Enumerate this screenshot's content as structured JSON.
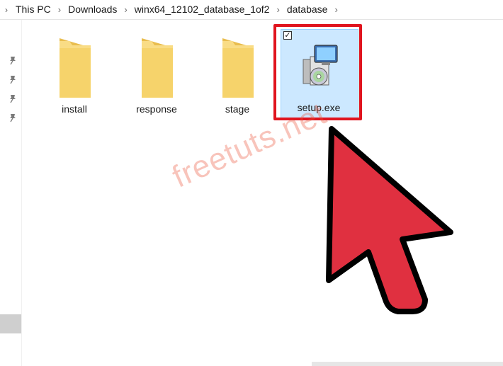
{
  "breadcrumb": {
    "items": [
      "This PC",
      "Downloads",
      "winx64_12102_database_1of2",
      "database"
    ]
  },
  "files": {
    "install": "install",
    "response": "response",
    "stage": "stage",
    "setup": "setup.exe"
  },
  "watermark": "freetuts.net",
  "colors": {
    "folder": "#f6d36b",
    "selection": "#cce8ff",
    "highlight_frame": "#e0141e",
    "arrow_fill": "#e03040",
    "arrow_stroke": "#000000"
  },
  "icons": {
    "nav_arrow": "chevron-right-icon",
    "pins": "pin-icon",
    "folders": "folder-icon",
    "setup": "installer-icon",
    "cursor": "arrow-cursor-icon"
  }
}
